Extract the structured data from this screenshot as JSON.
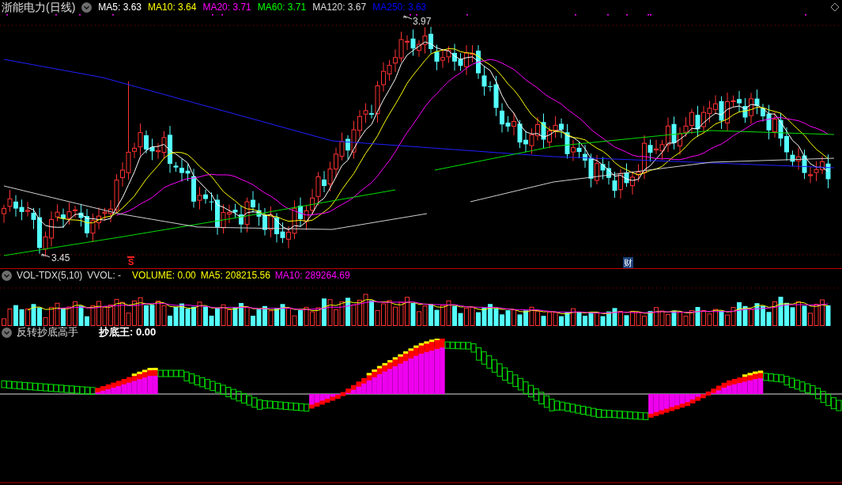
{
  "title": {
    "name": "浙能电力",
    "period": "(日线)"
  },
  "ma_legend": [
    {
      "label": "MA5: 3.63",
      "color": "#ffffff"
    },
    {
      "label": "MA10: 3.64",
      "color": "#ffff00"
    },
    {
      "label": "MA20: 3.71",
      "color": "#ff00ff"
    },
    {
      "label": "MA60: 3.71",
      "color": "#00ff00"
    },
    {
      "label": "MA120: 3.67",
      "color": "#dcdcdc"
    },
    {
      "label": "MA250: 3.63",
      "color": "#0000ff"
    }
  ],
  "main_chart": {
    "high_label": "3.97",
    "low_label": "3.45",
    "markers": [
      {
        "text": "S",
        "kind": "signal"
      },
      {
        "text": "财",
        "kind": "finance"
      }
    ]
  },
  "volume_panel": {
    "name": "VOL-TDX(5,10)",
    "items": [
      {
        "label": "VVOL: -",
        "color": "#dcdcdc"
      },
      {
        "label": "VOLUME: 0.00",
        "color": "#ffff00"
      },
      {
        "label": "MA5: 208215.56",
        "color": "#ffff00"
      },
      {
        "label": "MA10: 289264.69",
        "color": "#ff00ff"
      }
    ]
  },
  "indicator_panel": {
    "name": "反转抄底高手",
    "items": [
      {
        "label": "抄底王: 0.00",
        "color": "#ffffff"
      }
    ]
  }
}
